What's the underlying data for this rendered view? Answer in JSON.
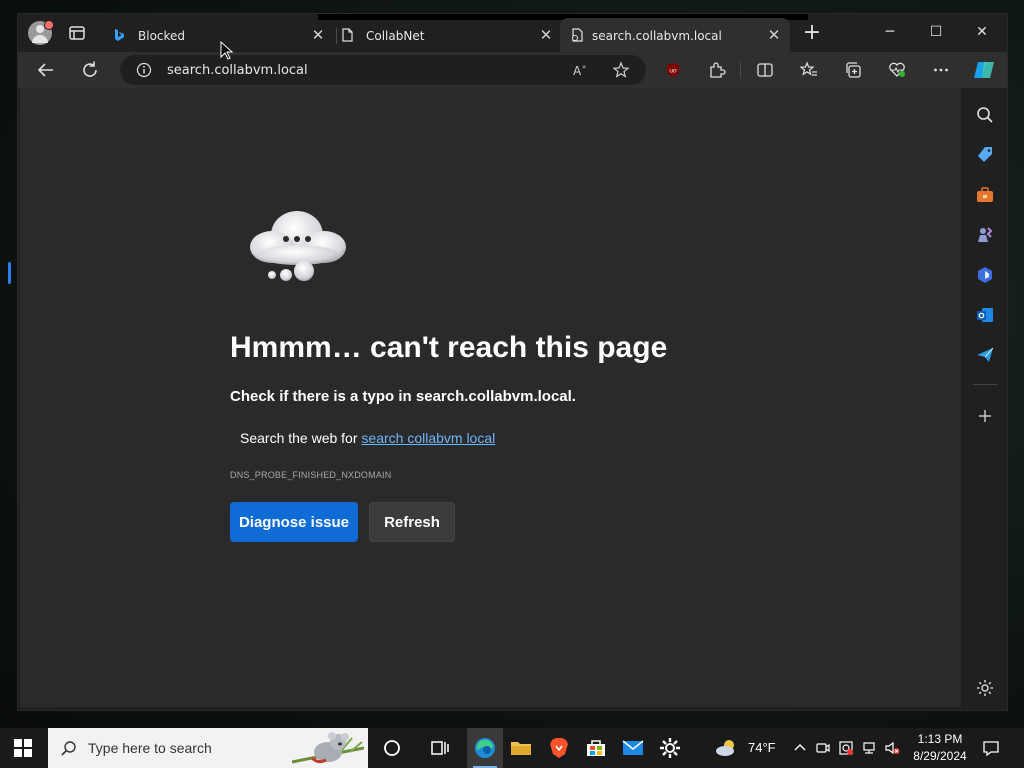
{
  "browser": {
    "tabs": [
      {
        "label": "Blocked",
        "favicon": "bing-icon",
        "active": false
      },
      {
        "label": "CollabNet",
        "favicon": "page-icon",
        "active": false
      },
      {
        "label": "search.collabvm.local",
        "favicon": "broken-page-icon",
        "active": true
      }
    ],
    "address": {
      "url": "search.collabvm.local"
    },
    "colors": {
      "accent": "#0f6cd6",
      "background": "#2a2a2a",
      "link": "#6cb6ff"
    }
  },
  "page": {
    "headline": "Hmmm… can't reach this page",
    "subtext": "Check if there is a typo in search.collabvm.local.",
    "search_prefix": "Search the web for",
    "search_link": "search collabvm local",
    "error_code": "DNS_PROBE_FINISHED_NXDOMAIN",
    "diagnose_label": "Diagnose issue",
    "refresh_label": "Refresh"
  },
  "taskbar": {
    "search_placeholder": "Type here to search",
    "temperature": "74°F",
    "time": "1:13 PM",
    "date": "8/29/2024"
  }
}
